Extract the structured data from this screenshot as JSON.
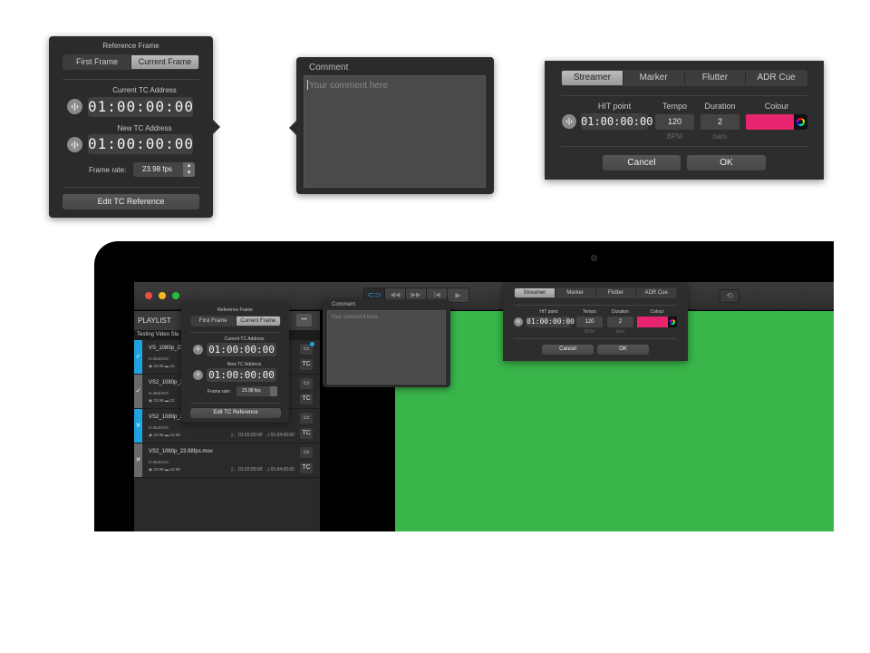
{
  "tc_popover": {
    "title": "Reference Frame",
    "segments": [
      "First Frame",
      "Current Frame"
    ],
    "selected": "Current Frame",
    "current_label": "Current TC Address",
    "current_tc": "01:00:00:00",
    "new_label": "New TC Address",
    "new_tc": "01:00:00:00",
    "framerate_label": "Frame rate:",
    "framerate_value": "23.98 fps",
    "edit_button": "Edit TC Reference"
  },
  "comment_popover": {
    "title": "Comment",
    "placeholder": "Your comment here"
  },
  "cue_dialog": {
    "tabs": [
      "Streamer",
      "Marker",
      "Flutter",
      "ADR Cue"
    ],
    "selected_tab": "Streamer",
    "hit_label": "HIT point",
    "hit_tc": "01:00:00:00",
    "tempo_label": "Tempo",
    "tempo_value": "120",
    "tempo_unit": "BPM",
    "duration_label": "Duration",
    "duration_value": "2",
    "duration_unit": "bars",
    "colour_label": "Colour",
    "colour_value": "#e8246e",
    "cancel": "Cancel",
    "ok": "OK"
  },
  "app": {
    "playlist_title": "PLAYLIST",
    "playlist_subtitle": "Testing Video Sla",
    "more_button": "•••",
    "items": [
      {
        "name": "VS_1080p_23",
        "codec": "H.264/AVC",
        "fps": "23.98",
        "vfps": "23",
        "in": "",
        "out": "",
        "status": "✓",
        "strip": "#1fa3e0"
      },
      {
        "name": "VS2_1080p_2",
        "codec": "H.264/AVC",
        "fps": "23.98",
        "vfps": "23",
        "in": "",
        "out": "",
        "status": "✓",
        "strip": "#6a6a6a"
      },
      {
        "name": "VS2_1080p_2",
        "codec": "H.264/AVC",
        "fps": "23.98",
        "vfps": "23.98",
        "in": "01:02:00:00",
        "out": "01:04:00:00",
        "status": "✕",
        "strip": "#1fa3e0"
      },
      {
        "name": "VS2_1080p_23.98fps.mov",
        "codec": "H.264/AVC",
        "fps": "23.98",
        "vfps": "23.98",
        "in": "01:02:00:00",
        "out": "01:04:00:00",
        "status": "✕",
        "strip": "#6a6a6a"
      }
    ],
    "tc_badge": "TC",
    "video_color": "#39b54a",
    "accent": "#1fa3e0"
  }
}
